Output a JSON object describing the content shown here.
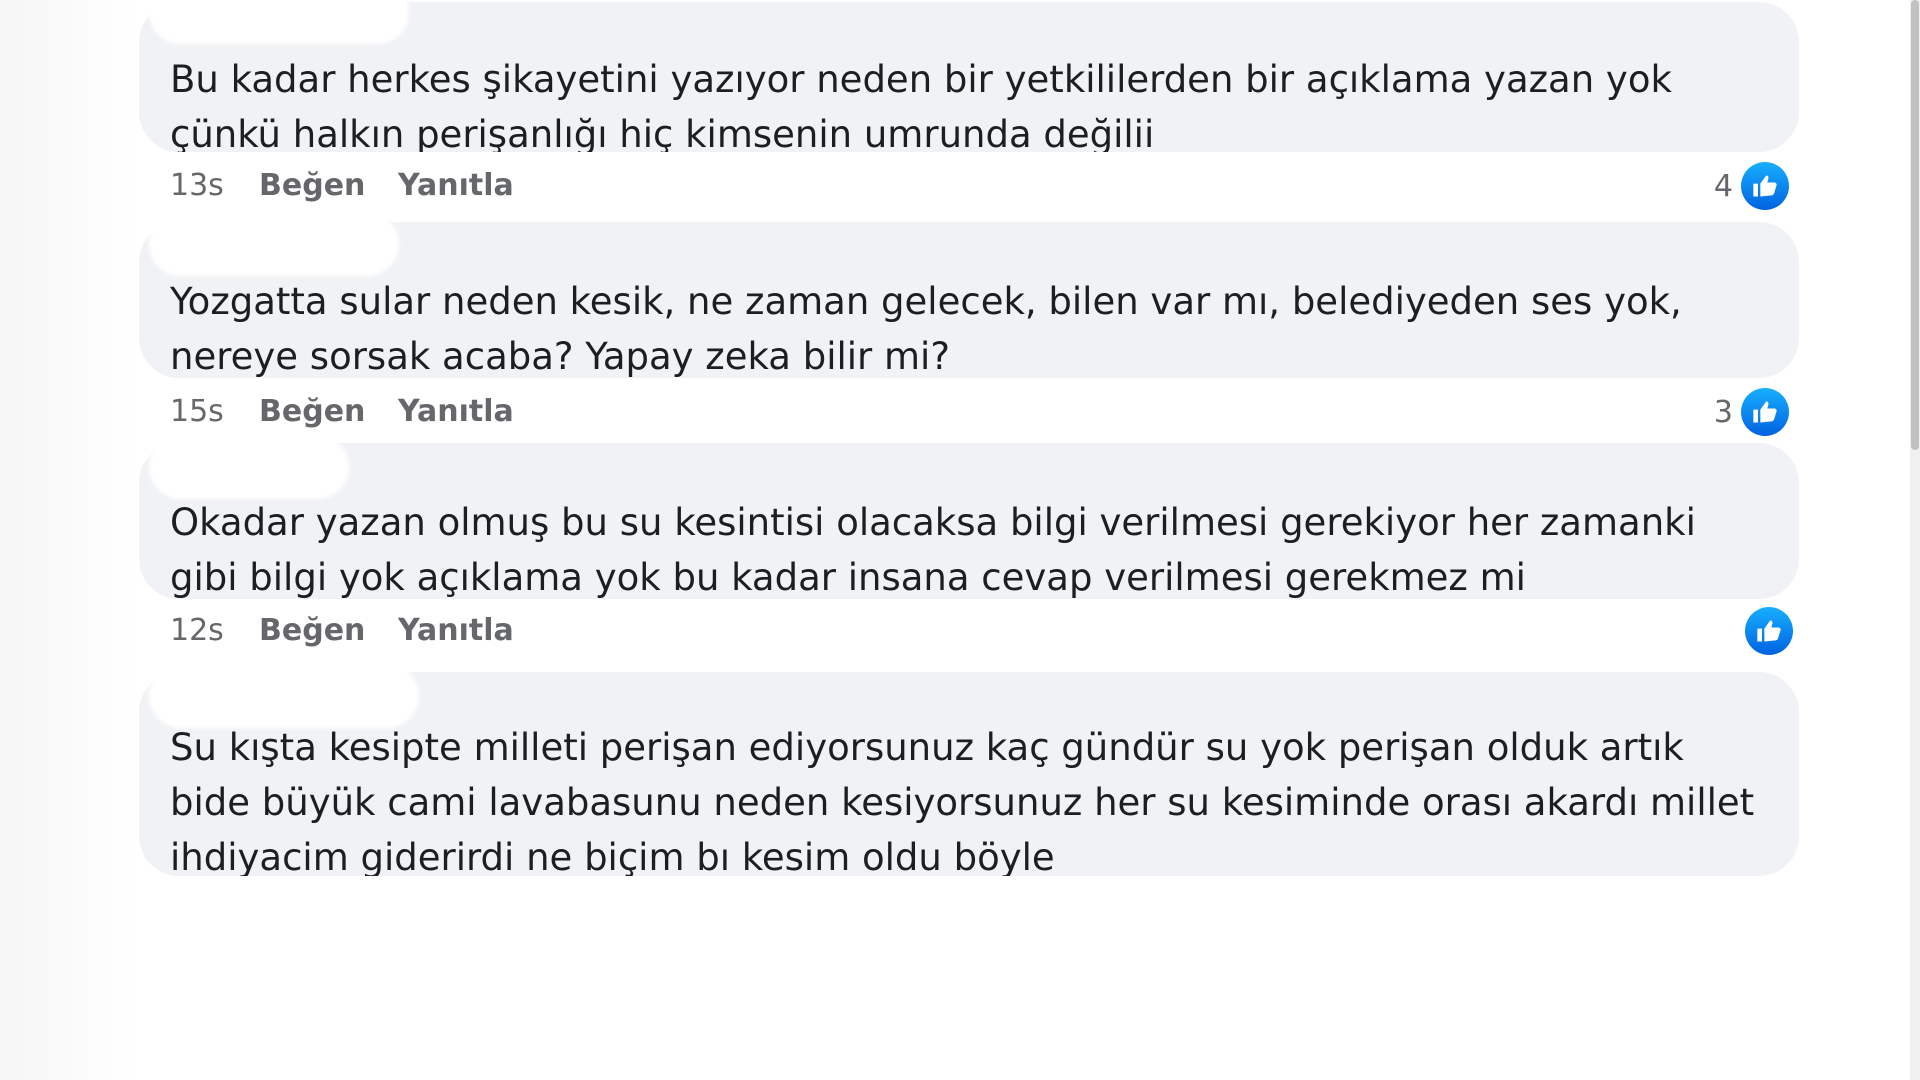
{
  "comments": [
    {
      "text": "Bu kadar herkes şikayetini yazıyor neden bir yetkililerden bir açıklama yazan yok çünkü halkın perişanlığı hiç kimsenin umrunda değilii",
      "time": "13s",
      "like_label": "Beğen",
      "reply_label": "Yanıtla",
      "reaction_count": "4",
      "reaction_icon": "like-thumb-icon"
    },
    {
      "text": "Yozgatta sular neden kesik, ne zaman gelecek, bilen var mı, belediyeden ses yok, nereye sorsak acaba? Yapay zeka bilir mi?",
      "time": "15s",
      "like_label": "Beğen",
      "reply_label": "Yanıtla",
      "reaction_count": "3",
      "reaction_icon": "like-thumb-icon"
    },
    {
      "text": "Okadar yazan olmuş bu su kesintisi olacaksa bilgi verilmesi gerekiyor her zamanki gibi bilgi yok açıklama yok bu kadar insana cevap verilmesi gerekmez mi",
      "time": "12s",
      "like_label": "Beğen",
      "reply_label": "Yanıtla",
      "reaction_count": "",
      "reaction_icon": "like-thumb-icon"
    },
    {
      "text": "Su kışta kesipte milleti perişan ediyorsunuz kaç gündür su yok perişan olduk artık bide büyük cami lavabasunu neden kesiyorsunuz her su kesiminde orası akardı millet ihdiyacim giderirdi ne biçim bı kesim oldu böyle"
    }
  ],
  "colors": {
    "bubble_bg": "#f0f2f5",
    "meta_text": "#65676b",
    "like_blue": "#0866ff"
  }
}
